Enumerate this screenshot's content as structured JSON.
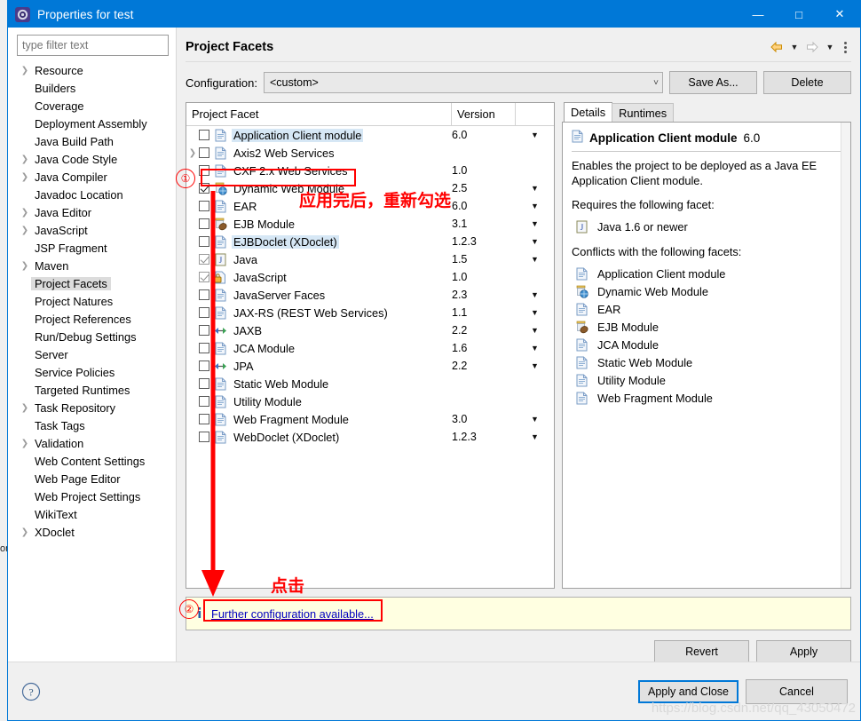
{
  "window": {
    "title": "Properties for test",
    "icon": "eclipse-gear-icon",
    "minimize_label": "—",
    "maximize_label": "□",
    "close_label": "✕"
  },
  "sidebar": {
    "filter_placeholder": "type filter text",
    "filter_value": "",
    "items": [
      {
        "label": "Resource",
        "expandable": true,
        "selected": false
      },
      {
        "label": "Builders",
        "expandable": false,
        "selected": false
      },
      {
        "label": "Coverage",
        "expandable": false,
        "selected": false
      },
      {
        "label": "Deployment Assembly",
        "expandable": false,
        "selected": false
      },
      {
        "label": "Java Build Path",
        "expandable": false,
        "selected": false
      },
      {
        "label": "Java Code Style",
        "expandable": true,
        "selected": false
      },
      {
        "label": "Java Compiler",
        "expandable": true,
        "selected": false
      },
      {
        "label": "Javadoc Location",
        "expandable": false,
        "selected": false
      },
      {
        "label": "Java Editor",
        "expandable": true,
        "selected": false
      },
      {
        "label": "JavaScript",
        "expandable": true,
        "selected": false
      },
      {
        "label": "JSP Fragment",
        "expandable": false,
        "selected": false
      },
      {
        "label": "Maven",
        "expandable": true,
        "selected": false
      },
      {
        "label": "Project Facets",
        "expandable": false,
        "selected": true
      },
      {
        "label": "Project Natures",
        "expandable": false,
        "selected": false
      },
      {
        "label": "Project References",
        "expandable": false,
        "selected": false
      },
      {
        "label": "Run/Debug Settings",
        "expandable": false,
        "selected": false
      },
      {
        "label": "Server",
        "expandable": false,
        "selected": false
      },
      {
        "label": "Service Policies",
        "expandable": false,
        "selected": false
      },
      {
        "label": "Targeted Runtimes",
        "expandable": false,
        "selected": false
      },
      {
        "label": "Task Repository",
        "expandable": true,
        "selected": false
      },
      {
        "label": "Task Tags",
        "expandable": false,
        "selected": false
      },
      {
        "label": "Validation",
        "expandable": true,
        "selected": false
      },
      {
        "label": "Web Content Settings",
        "expandable": false,
        "selected": false
      },
      {
        "label": "Web Page Editor",
        "expandable": false,
        "selected": false
      },
      {
        "label": "Web Project Settings",
        "expandable": false,
        "selected": false
      },
      {
        "label": "WikiText",
        "expandable": false,
        "selected": false
      },
      {
        "label": "XDoclet",
        "expandable": true,
        "selected": false
      }
    ]
  },
  "page": {
    "title": "Project Facets",
    "back_icon": "back-arrow-icon",
    "forward_icon": "forward-arrow-icon",
    "menu_icon": "view-menu-icon"
  },
  "configuration": {
    "label": "Configuration:",
    "value": "<custom>",
    "save_as_label": "Save As...",
    "delete_label": "Delete"
  },
  "facet_table": {
    "col_facet": "Project Facet",
    "col_version": "Version",
    "rows": [
      {
        "name": "Application Client module",
        "version": "6.0",
        "checked": false,
        "locked": false,
        "expandable": false,
        "icon": "document-icon",
        "highlighted": true,
        "has_version_menu": true
      },
      {
        "name": "Axis2 Web Services",
        "version": "",
        "checked": false,
        "locked": false,
        "expandable": true,
        "icon": "document-icon",
        "highlighted": false,
        "has_version_menu": false
      },
      {
        "name": "CXF 2.x Web Services",
        "version": "1.0",
        "checked": false,
        "locked": false,
        "expandable": false,
        "icon": "document-icon",
        "highlighted": false,
        "has_version_menu": false
      },
      {
        "name": "Dynamic Web Module",
        "version": "2.5",
        "checked": true,
        "locked": false,
        "expandable": false,
        "icon": "web-module-icon",
        "highlighted": false,
        "has_version_menu": true
      },
      {
        "name": "EAR",
        "version": "6.0",
        "checked": false,
        "locked": false,
        "expandable": false,
        "icon": "document-icon",
        "highlighted": false,
        "has_version_menu": true
      },
      {
        "name": "EJB Module",
        "version": "3.1",
        "checked": false,
        "locked": false,
        "expandable": false,
        "icon": "ejb-module-icon",
        "highlighted": false,
        "has_version_menu": true
      },
      {
        "name": "EJBDoclet (XDoclet)",
        "version": "1.2.3",
        "checked": false,
        "locked": false,
        "expandable": false,
        "icon": "document-icon",
        "highlighted": true,
        "has_version_menu": true
      },
      {
        "name": "Java",
        "version": "1.5",
        "checked": true,
        "locked": true,
        "expandable": false,
        "icon": "java-icon",
        "highlighted": false,
        "has_version_menu": true
      },
      {
        "name": "JavaScript",
        "version": "1.0",
        "checked": true,
        "locked": true,
        "expandable": false,
        "icon": "javascript-lock-icon",
        "highlighted": false,
        "has_version_menu": false
      },
      {
        "name": "JavaServer Faces",
        "version": "2.3",
        "checked": false,
        "locked": false,
        "expandable": false,
        "icon": "document-icon",
        "highlighted": false,
        "has_version_menu": true
      },
      {
        "name": "JAX-RS (REST Web Services)",
        "version": "1.1",
        "checked": false,
        "locked": false,
        "expandable": false,
        "icon": "document-icon",
        "highlighted": false,
        "has_version_menu": true
      },
      {
        "name": "JAXB",
        "version": "2.2",
        "checked": false,
        "locked": false,
        "expandable": false,
        "icon": "jaxb-icon",
        "highlighted": false,
        "has_version_menu": true
      },
      {
        "name": "JCA Module",
        "version": "1.6",
        "checked": false,
        "locked": false,
        "expandable": false,
        "icon": "document-icon",
        "highlighted": false,
        "has_version_menu": true
      },
      {
        "name": "JPA",
        "version": "2.2",
        "checked": false,
        "locked": false,
        "expandable": false,
        "icon": "jaxb-icon",
        "highlighted": false,
        "has_version_menu": true
      },
      {
        "name": "Static Web Module",
        "version": "",
        "checked": false,
        "locked": false,
        "expandable": false,
        "icon": "document-icon",
        "highlighted": false,
        "has_version_menu": false
      },
      {
        "name": "Utility Module",
        "version": "",
        "checked": false,
        "locked": false,
        "expandable": false,
        "icon": "document-icon",
        "highlighted": false,
        "has_version_menu": false
      },
      {
        "name": "Web Fragment Module",
        "version": "3.0",
        "checked": false,
        "locked": false,
        "expandable": false,
        "icon": "document-icon",
        "highlighted": false,
        "has_version_menu": true
      },
      {
        "name": "WebDoclet (XDoclet)",
        "version": "1.2.3",
        "checked": false,
        "locked": false,
        "expandable": false,
        "icon": "document-icon",
        "highlighted": false,
        "has_version_menu": true
      }
    ]
  },
  "details": {
    "tabs": [
      {
        "label": "Details",
        "active": true
      },
      {
        "label": "Runtimes",
        "active": false
      }
    ],
    "facet_title": "Application Client module",
    "facet_version": "6.0",
    "description": "Enables the project to be deployed as a Java EE Application Client module.",
    "requires_heading": "Requires the following facet:",
    "requires": [
      {
        "label": "Java 1.6 or newer",
        "icon": "java-icon"
      }
    ],
    "conflicts_heading": "Conflicts with the following facets:",
    "conflicts": [
      {
        "label": "Application Client module",
        "icon": "document-icon"
      },
      {
        "label": "Dynamic Web Module",
        "icon": "web-module-icon"
      },
      {
        "label": "EAR",
        "icon": "document-icon"
      },
      {
        "label": "EJB Module",
        "icon": "ejb-module-icon"
      },
      {
        "label": "JCA Module",
        "icon": "document-icon"
      },
      {
        "label": "Static Web Module",
        "icon": "document-icon"
      },
      {
        "label": "Utility Module",
        "icon": "document-icon"
      },
      {
        "label": "Web Fragment Module",
        "icon": "document-icon"
      }
    ]
  },
  "info_bar": {
    "icon": "info-icon",
    "link_text": "Further configuration available..."
  },
  "pane_buttons": {
    "revert": "Revert",
    "apply": "Apply"
  },
  "footer": {
    "help_icon": "help-question-icon",
    "apply_and_close": "Apply and Close",
    "cancel": "Cancel"
  },
  "annotations": {
    "marker_one": "①",
    "marker_two": "②",
    "note_reselect": "应用完后，重新勾选",
    "note_click": "点击",
    "color": "#ff0000"
  },
  "background_artifact": {
    "text": "on"
  },
  "watermark": {
    "text": "https://blog.csdn.net/qq_43050472"
  }
}
